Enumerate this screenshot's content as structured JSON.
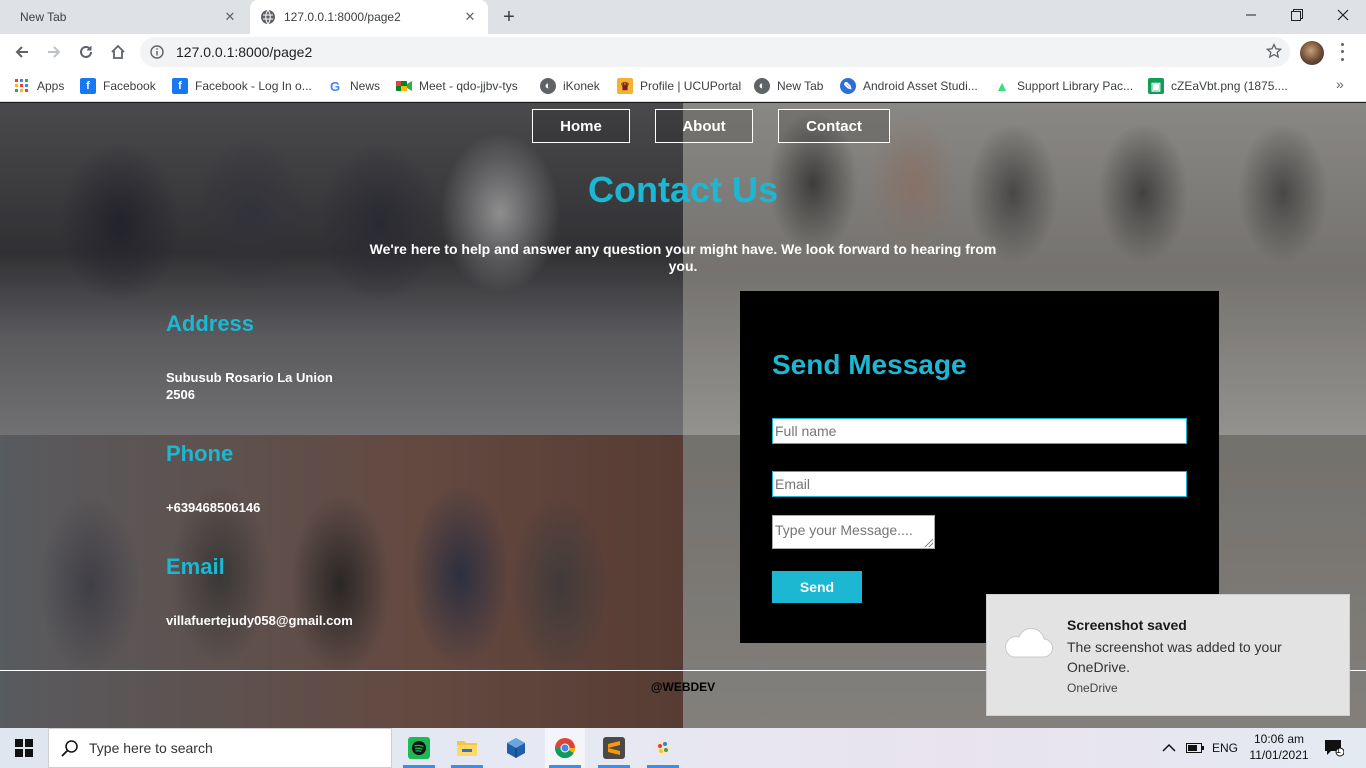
{
  "browser": {
    "tabs": [
      {
        "title": "New Tab",
        "active": false
      },
      {
        "title": "127.0.0.1:8000/page2",
        "active": true
      }
    ],
    "url": "127.0.0.1:8000/page2",
    "bookmarks": [
      {
        "label": "Apps",
        "icon": "apps-grid-icon"
      },
      {
        "label": "Facebook",
        "icon": "facebook-icon"
      },
      {
        "label": "Facebook - Log In o...",
        "icon": "facebook-icon"
      },
      {
        "label": "News",
        "icon": "google-icon"
      },
      {
        "label": "Meet - qdo-jjbv-tys",
        "icon": "meet-icon"
      },
      {
        "label": "iKonek",
        "icon": "globe-icon"
      },
      {
        "label": "Profile | UCUPortal",
        "icon": "portal-icon"
      },
      {
        "label": "New Tab",
        "icon": "globe-icon"
      },
      {
        "label": "Android Asset Studi...",
        "icon": "android-studio-icon"
      },
      {
        "label": "Support Library Pac...",
        "icon": "android-icon"
      },
      {
        "label": "cZEaVbt.png (1875....",
        "icon": "image-file-icon"
      }
    ]
  },
  "page": {
    "nav": [
      "Home",
      "About",
      "Contact"
    ],
    "title": "Contact Us",
    "intro": "We're here to help and answer any question your might have. We look forward to hearing from you.",
    "address": {
      "heading": "Address",
      "line1": "Subusub Rosario La Union",
      "line2": "2506"
    },
    "phone": {
      "heading": "Phone",
      "value": "+639468506146"
    },
    "email": {
      "heading": "Email",
      "value": "villafuertejudy058@gmail.com"
    },
    "form": {
      "title": "Send Message",
      "fullname_placeholder": "Full name",
      "email_placeholder": "Email",
      "message_placeholder": "Type your Message....",
      "send_label": "Send"
    },
    "footer": "@WEBDEV"
  },
  "toast": {
    "title": "Screenshot saved",
    "body": "The screenshot was added to your OneDrive.",
    "source": "OneDrive"
  },
  "taskbar": {
    "search_placeholder": "Type here to search",
    "language": "ENG",
    "time": "10:06 am",
    "date": "11/01/2021",
    "notification_count": "1"
  },
  "colors": {
    "accent": "#1bb7d3",
    "form_bg": "#000000"
  }
}
